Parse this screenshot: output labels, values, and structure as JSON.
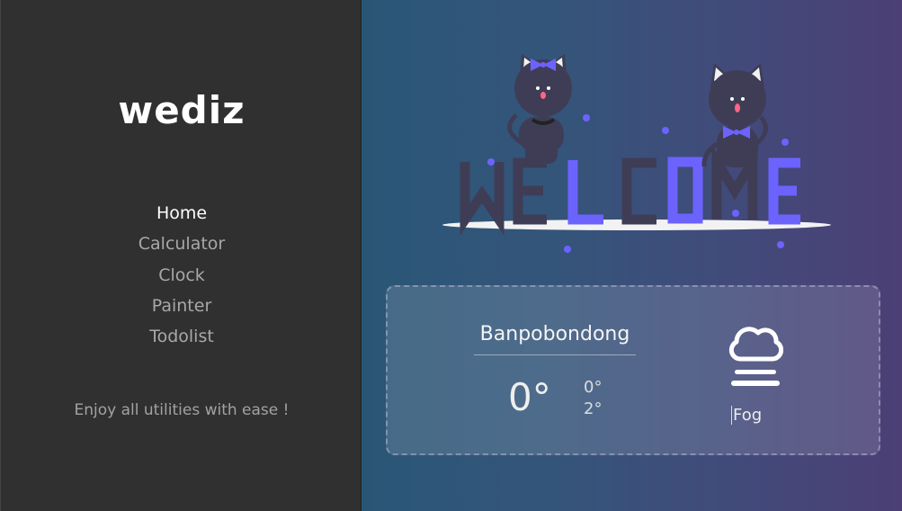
{
  "app": {
    "logo": "wediz",
    "tagline": "Enjoy all utilities with ease !"
  },
  "nav": {
    "items": [
      "Home",
      "Calculator",
      "Clock",
      "Painter",
      "Todolist"
    ],
    "active": "Home"
  },
  "hero": {
    "banner_text": "WELCOME"
  },
  "weather": {
    "city": "Banpobondong",
    "temp": "0°",
    "temp_min": "0°",
    "temp_max": "2°",
    "description": "Fog",
    "icon": "fog-icon"
  },
  "colors": {
    "sidebar": "#303030",
    "accent": "#6c63ff",
    "cat": "#3f3d56",
    "gradient_start": "#2a5676",
    "gradient_end": "#4c3f76"
  }
}
